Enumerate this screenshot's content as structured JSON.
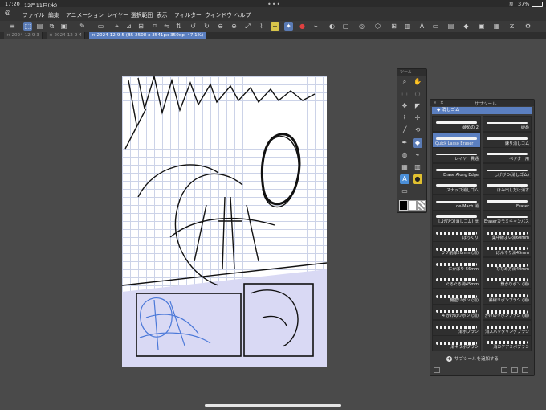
{
  "status": {
    "time": "17:20",
    "date": "12月11日(水)",
    "wifi_icon": "wifi-icon",
    "battery": "37%"
  },
  "menu": [
    "ファイル",
    "編集",
    "アニメーション",
    "レイヤー",
    "選択範囲",
    "表示",
    "フィルター",
    "ウィンドウ",
    "ヘルプ"
  ],
  "tabs": [
    {
      "label": "2024-12-9-3"
    },
    {
      "label": "2024-12-9-4"
    },
    {
      "label": "2024-12-9-5 (B5 2508 x 3541px 350dpi 47.1%)",
      "active": true
    }
  ],
  "tool_palette": {
    "title": "ツール",
    "tools": [
      "zoom-icon",
      "hand-icon",
      "select-icon",
      "lasso-icon",
      "move-icon",
      "fill-icon",
      "eyedropper-icon",
      "spray-icon",
      "pen-icon",
      "eraser-icon",
      "blend-icon",
      "decoration-icon",
      "frame-icon",
      "gradient-icon",
      "text-icon",
      "balloon-icon",
      "correction-icon"
    ]
  },
  "subtool": {
    "title": "サブツール",
    "group": "消しゴム",
    "brushes": [
      {
        "label": "硬めの 2"
      },
      {
        "label": "硬め"
      },
      {
        "label": "Quick Lasso Eraser",
        "selected": true
      },
      {
        "label": "練り消しゴム"
      },
      {
        "label": "レイヤー貫通"
      },
      {
        "label": "ベクター用"
      },
      {
        "label": "Erase Along Edge"
      },
      {
        "label": "しげびつ(消しゴム)"
      },
      {
        "label": "スナップ消しゴム"
      },
      {
        "label": "はみ出しだけ消す"
      },
      {
        "label": "de-Mach 消"
      },
      {
        "label": "Eraser"
      },
      {
        "label": "しげびつ(消しゴム) 厚"
      },
      {
        "label": "Eraserカモミキャンバス"
      },
      {
        "label": "ぼっくり"
      },
      {
        "label": "集中線よい消60mm"
      },
      {
        "label": "ラフ削線20mm (消)"
      },
      {
        "label": "ぼんやり消45mm"
      },
      {
        "label": "にかばり 56mm"
      },
      {
        "label": "ななめ方消40mm"
      },
      {
        "label": "ぐるぐる消45mm"
      },
      {
        "label": "鎖かりボン (消)"
      },
      {
        "label": "機密リボン (消)"
      },
      {
        "label": "斜線リボンブラシ (消)"
      },
      {
        "label": "4 かけのリボン (消)"
      },
      {
        "label": "かけのリボンブラシ (消)"
      },
      {
        "label": "消ボブラシ"
      },
      {
        "label": "消スパッタリングブラシ"
      },
      {
        "label": "消キラボブラシ"
      },
      {
        "label": "消カケアミボブラシ"
      }
    ],
    "add_label": "サブツールを追加する"
  }
}
